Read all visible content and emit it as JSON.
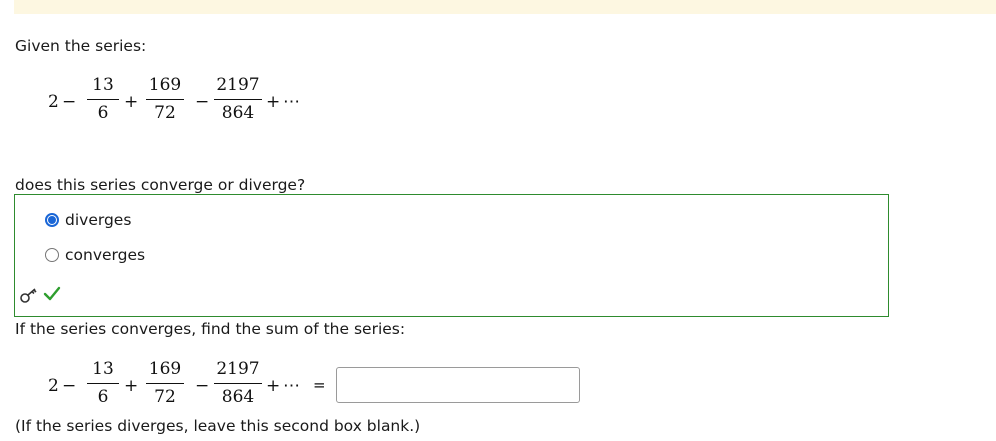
{
  "prompt": "Given the series:",
  "series": {
    "first_term": "2",
    "ops": [
      "−",
      "+",
      "−",
      "+"
    ],
    "fractions": [
      {
        "num": "13",
        "den": "6"
      },
      {
        "num": "169",
        "den": "72"
      },
      {
        "num": "2197",
        "den": "864"
      }
    ],
    "ellipsis": "⋯",
    "equals": "="
  },
  "question": "does this series converge or diverge?",
  "options": [
    {
      "label": "diverges",
      "selected": true
    },
    {
      "label": "converges",
      "selected": false
    }
  ],
  "feedback": {
    "key_icon": "key-icon",
    "status_icon": "checkmark-icon",
    "status_color": "#2e9e2e"
  },
  "sum_question": "If the series converges, find the sum of the series:",
  "sum_input": {
    "value": ""
  },
  "note": "(If the series diverges, leave this second box blank.)",
  "colors": {
    "topbar": "#fdf7e1",
    "box_border": "#2e8b2e",
    "radio_selected": "#1a66d6"
  }
}
